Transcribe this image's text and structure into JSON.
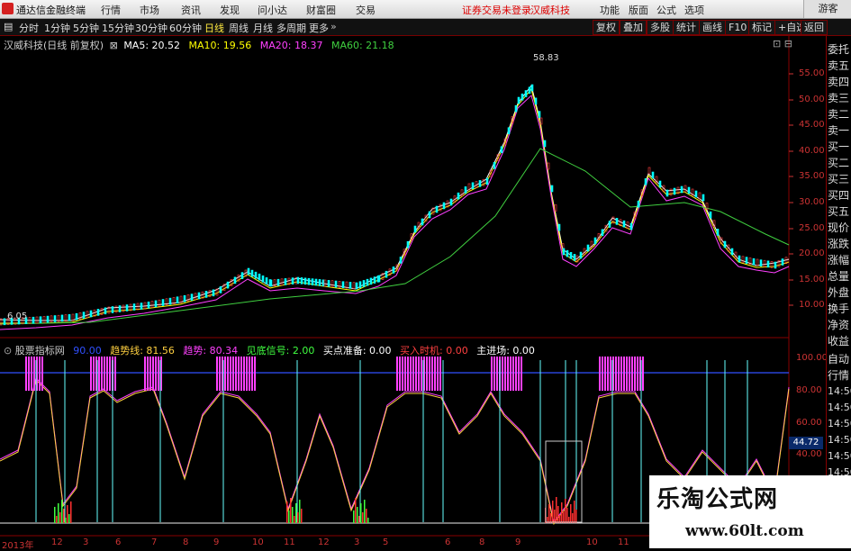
{
  "menubar": {
    "app_title": "通达信金融终端",
    "items": [
      "行情",
      "市场",
      "资讯",
      "发现",
      "问小达",
      "财富圈",
      "交易"
    ],
    "notice": "证券交易未登录",
    "stock_name": "汉威科技",
    "right_items": [
      "功能",
      "版面",
      "公式",
      "选项"
    ],
    "login": "游客"
  },
  "toolbar": {
    "periods": [
      "分时",
      "1分钟",
      "5分钟",
      "15分钟",
      "30分钟",
      "60分钟",
      "日线",
      "周线",
      "月线",
      "多周期",
      "更多"
    ],
    "active_period": "日线",
    "right_buttons": [
      "复权",
      "叠加",
      "多股",
      "统计",
      "画线",
      "F10",
      "标记",
      "+自选",
      "返回"
    ]
  },
  "main_chart": {
    "title": "汉威科技(日线 前复权)",
    "ma": [
      {
        "label": "MA5: 20.52",
        "color": "#ffffff"
      },
      {
        "label": "MA10: 19.56",
        "color": "#ffff00"
      },
      {
        "label": "MA20: 18.37",
        "color": "#ff40ff"
      },
      {
        "label": "MA60: 21.18",
        "color": "#40d040"
      }
    ],
    "y_ticks": [
      "55.00",
      "50.00",
      "45.00",
      "40.00",
      "35.00",
      "30.00",
      "25.00",
      "20.00",
      "15.00",
      "10.00"
    ],
    "high_label": "58.83",
    "low_label": "6.05"
  },
  "sub_chart": {
    "title": "股票指标网",
    "indicators": [
      {
        "label": "90.00",
        "color": "#3050ff"
      },
      {
        "label": "趋势线: 81.56",
        "color": "#ffd040"
      },
      {
        "label": "趋势: 80.34",
        "color": "#ff40ff"
      },
      {
        "label": "见底信号: 2.00",
        "color": "#40ff40"
      },
      {
        "label": "买点准备: 0.00",
        "color": "#ffffff"
      },
      {
        "label": "买入时机: 0.00",
        "color": "#ff4040"
      },
      {
        "label": "主进场: 0.00",
        "color": "#ffffff"
      }
    ],
    "y_ticks": [
      "100.00",
      "80.00",
      "60.00",
      "40.00"
    ],
    "current_value": "44.72"
  },
  "x_axis": [
    "2013年",
    "12",
    "3",
    "6",
    "7",
    "8",
    "9",
    "10",
    "11",
    "12",
    "3",
    "5",
    "6",
    "8",
    "9",
    "10",
    "11"
  ],
  "right_panel": [
    "委托",
    "卖五",
    "卖四",
    "卖三",
    "卖二",
    "卖一",
    "买一",
    "买二",
    "买三",
    "买四",
    "买五",
    "现价",
    "涨跌",
    "涨幅",
    "总量",
    "外盘",
    "换手",
    "净资",
    "收益",
    "自动",
    "行情",
    "14:50",
    "14:50",
    "14:50",
    "14:50",
    "14:50",
    "14:50"
  ],
  "watermark": {
    "title": "乐淘公式网",
    "url": "www.60lt.com"
  }
}
